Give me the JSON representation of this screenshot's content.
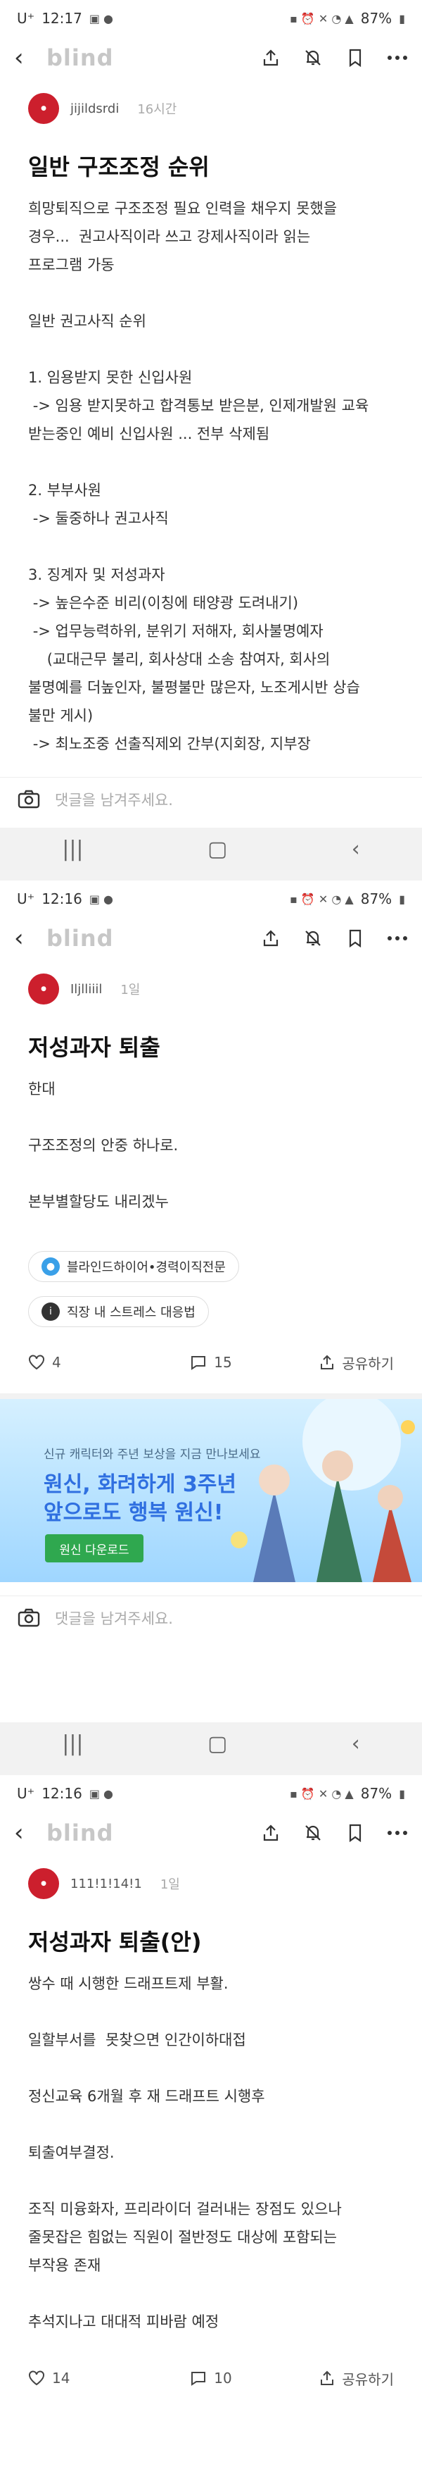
{
  "status": {
    "shot1_time": "12:17",
    "shot2_time": "12:16",
    "shot3_time": "12:16",
    "carrier": "U⁺",
    "battery": "87%"
  },
  "brand": "blind",
  "post1": {
    "author": "jijildsrdi",
    "time": "16시간",
    "title": "일반 구조조정 순위",
    "lines": [
      "희망퇴직으로 구조조정 필요 인력을 채우지 못했을",
      "경우...  권고사직이라 쓰고 강제사직이라 읽는",
      "프로그램 가동",
      "",
      "일반 권고사직 순위",
      "",
      "1. 임용받지 못한 신입사원",
      " -> 임용 받지못하고 합격통보 받은분, 인제개발원 교육",
      "받는중인 예비 신입사원 ... 전부 삭제됨",
      "",
      "2. 부부사원",
      " -> 둘중하나 권고사직",
      "",
      "3. 징계자 및 저성과자",
      " -> 높은수준 비리(이칭에 태양광 도려내기)",
      " -> 업무능력하위, 분위기 저해자, 회사불명예자",
      "    (교대근무 불리, 회사상대 소송 참여자, 회사의",
      "불명예를 더높인자, 불평불만 많은자, 노조게시반 상습",
      "불만 게시)",
      " -> 최노조중 선출직제외 간부(지회장, 지부장"
    ],
    "comment_placeholder": "댓글을 남겨주세요."
  },
  "post2": {
    "author": "Iljlliiil",
    "time": "1일",
    "title": "저성과자 퇴출",
    "lines": [
      "한대",
      "",
      "구조조정의 안중 하나로.",
      "",
      "본부별할당도 내리겠누"
    ],
    "chip1": "블라인드하이어•경력이직전문",
    "chip2": "직장 내 스트레스 대응법",
    "likes": "4",
    "comments": "15",
    "share": "공유하기",
    "ad_small": "신규 캐릭터와 주년 보상을 지금 만나보세요",
    "ad_big1": "원신, 화려하게 3주년",
    "ad_big2": "앞으로도 행복 원신!",
    "ad_button": "원신 다운로드",
    "comment_placeholder": "댓글을 남겨주세요."
  },
  "post3": {
    "author": "111!1!14!1",
    "time": "1일",
    "title": "저성과자 퇴출(안)",
    "lines": [
      "쌍수 때 시행한 드래프트제 부활.",
      "",
      "일할부서를  못찾으면 인간이하대접",
      "",
      "정신교육 6개월 후 재 드래프트 시행후",
      "",
      "퇴출여부결정.",
      "",
      "조직 미융화자, 프리라이더 걸러내는 장점도 있으나",
      "줄못잡은 힘없는 직원이 절반정도 대상에 포함되는",
      "부작용 존재",
      "",
      "추석지나고 대대적 피바람 예정"
    ],
    "likes": "14",
    "comments": "10",
    "share": "공유하기"
  },
  "icons": [
    "back-arrow-icon",
    "share-icon",
    "bell-off-icon",
    "bookmark-icon",
    "more-icon",
    "camera-icon",
    "heart-icon",
    "comment-icon",
    "upload-icon"
  ],
  "colors": {
    "brand_grey": "#c7c7c7",
    "avatar_red": "#cc1f2d",
    "ad_blue": "#2f6fe0",
    "ad_green": "#2fa84f"
  }
}
